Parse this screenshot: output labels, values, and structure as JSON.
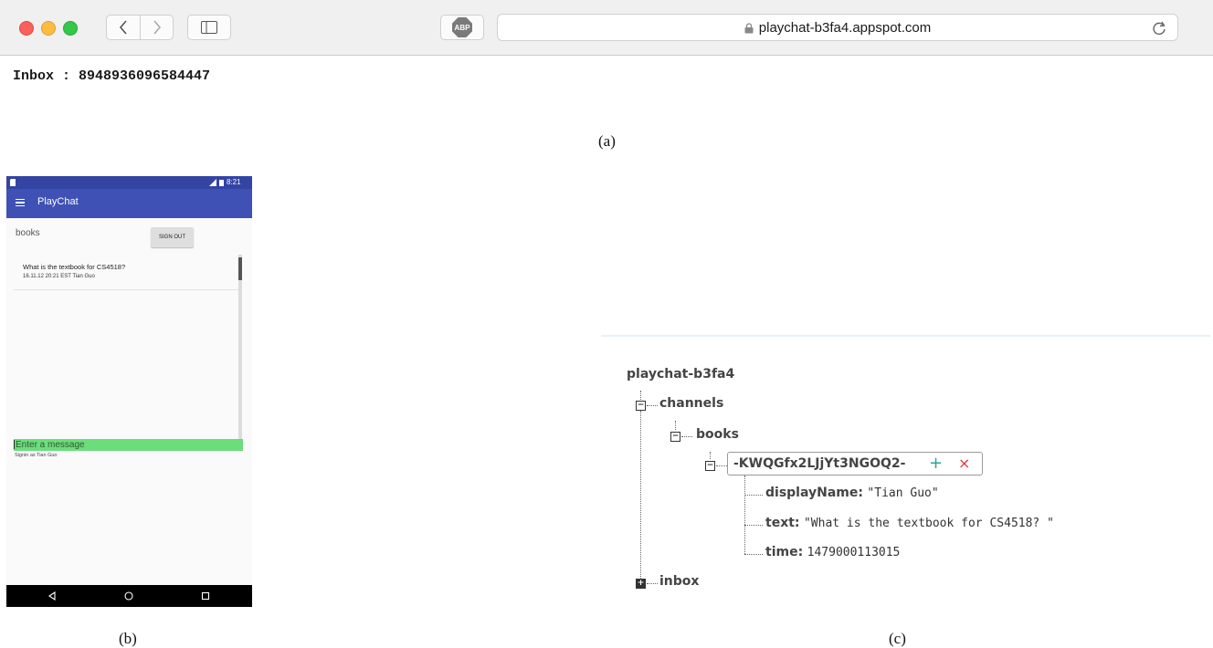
{
  "browser": {
    "url": "playchat-b3fa4.appspot.com",
    "adblock_label": "ABP"
  },
  "inbox": {
    "text": "Inbox : 8948936096584447"
  },
  "captions": {
    "a": "(a)",
    "b": "(b)",
    "c": "(c)"
  },
  "phone": {
    "status_time": "8:21",
    "app_title": "PlayChat",
    "channel_label": "books",
    "signout_label": "SIGN OUT",
    "messages": [
      {
        "text": "What is the textbook for CS4518?",
        "meta": "16.11.12 20:21 EST Tian Guo"
      }
    ],
    "input_placeholder": "Enter a message",
    "signin_status": "Signin as Tian Guo"
  },
  "firebase": {
    "root": "playchat-b3fa4",
    "channels_label": "channels",
    "books_label": "books",
    "message_key": "-KWQGfx2LJjYt3NGOQ2-",
    "add_symbol": "+",
    "delete_symbol": "×",
    "fields": [
      {
        "key": "displayName:",
        "value": "\"Tian Guo\""
      },
      {
        "key": "text:",
        "value": "\"What is the textbook for CS4518? \""
      },
      {
        "key": "time:",
        "value": "1479000113015"
      }
    ],
    "inbox_label": "inbox",
    "collapse_symbol": "−",
    "expand_symbol": "+"
  }
}
